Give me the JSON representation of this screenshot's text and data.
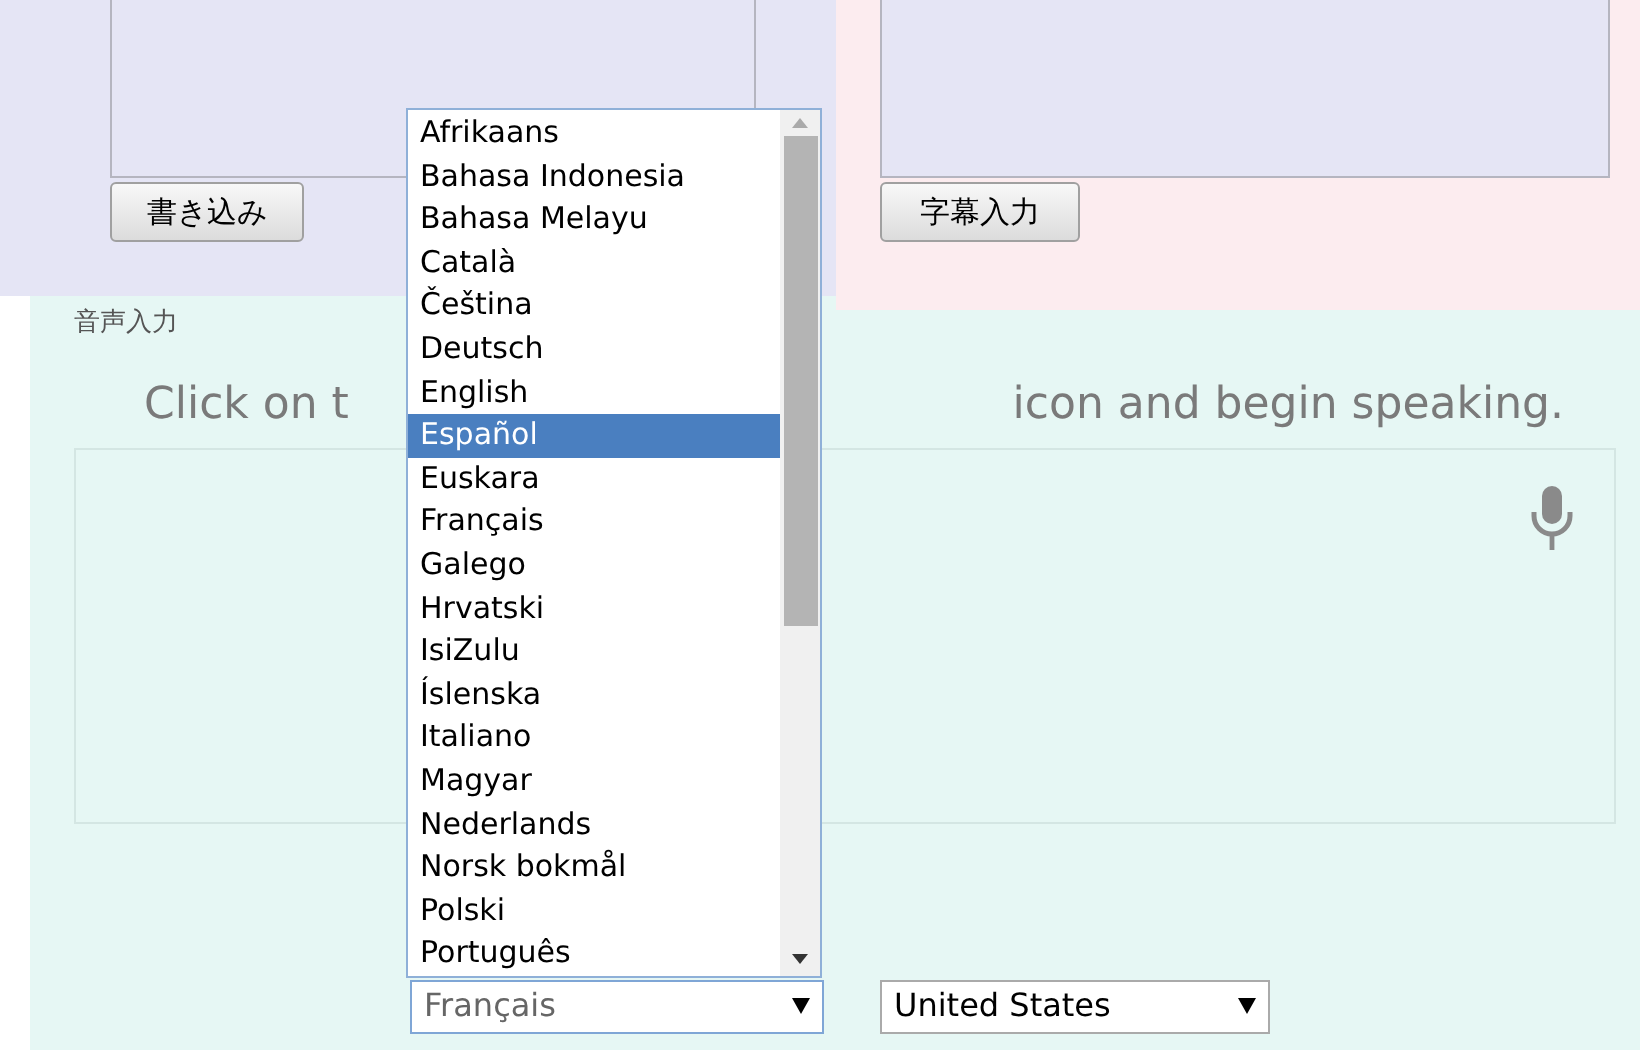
{
  "write_panel": {
    "button": "書き込み"
  },
  "caption_panel": {
    "button": "字幕入力"
  },
  "voice_panel": {
    "label": "音声入力",
    "prompt_parts": [
      "Click on t",
      "icon and begin speaking."
    ]
  },
  "language_select": {
    "value": "Français"
  },
  "country_select": {
    "value": "United States"
  },
  "language_list": [
    {
      "label": "Afrikaans",
      "selected": false
    },
    {
      "label": "Bahasa Indonesia",
      "selected": false
    },
    {
      "label": "Bahasa Melayu",
      "selected": false
    },
    {
      "label": "Català",
      "selected": false
    },
    {
      "label": "Čeština",
      "selected": false
    },
    {
      "label": "Deutsch",
      "selected": false
    },
    {
      "label": "English",
      "selected": false
    },
    {
      "label": "Español",
      "selected": true
    },
    {
      "label": "Euskara",
      "selected": false
    },
    {
      "label": "Français",
      "selected": false
    },
    {
      "label": "Galego",
      "selected": false
    },
    {
      "label": "Hrvatski",
      "selected": false
    },
    {
      "label": "IsiZulu",
      "selected": false
    },
    {
      "label": "Íslenska",
      "selected": false
    },
    {
      "label": "Italiano",
      "selected": false
    },
    {
      "label": "Magyar",
      "selected": false
    },
    {
      "label": "Nederlands",
      "selected": false
    },
    {
      "label": "Norsk bokmål",
      "selected": false
    },
    {
      "label": "Polski",
      "selected": false
    },
    {
      "label": "Português",
      "selected": false
    }
  ]
}
